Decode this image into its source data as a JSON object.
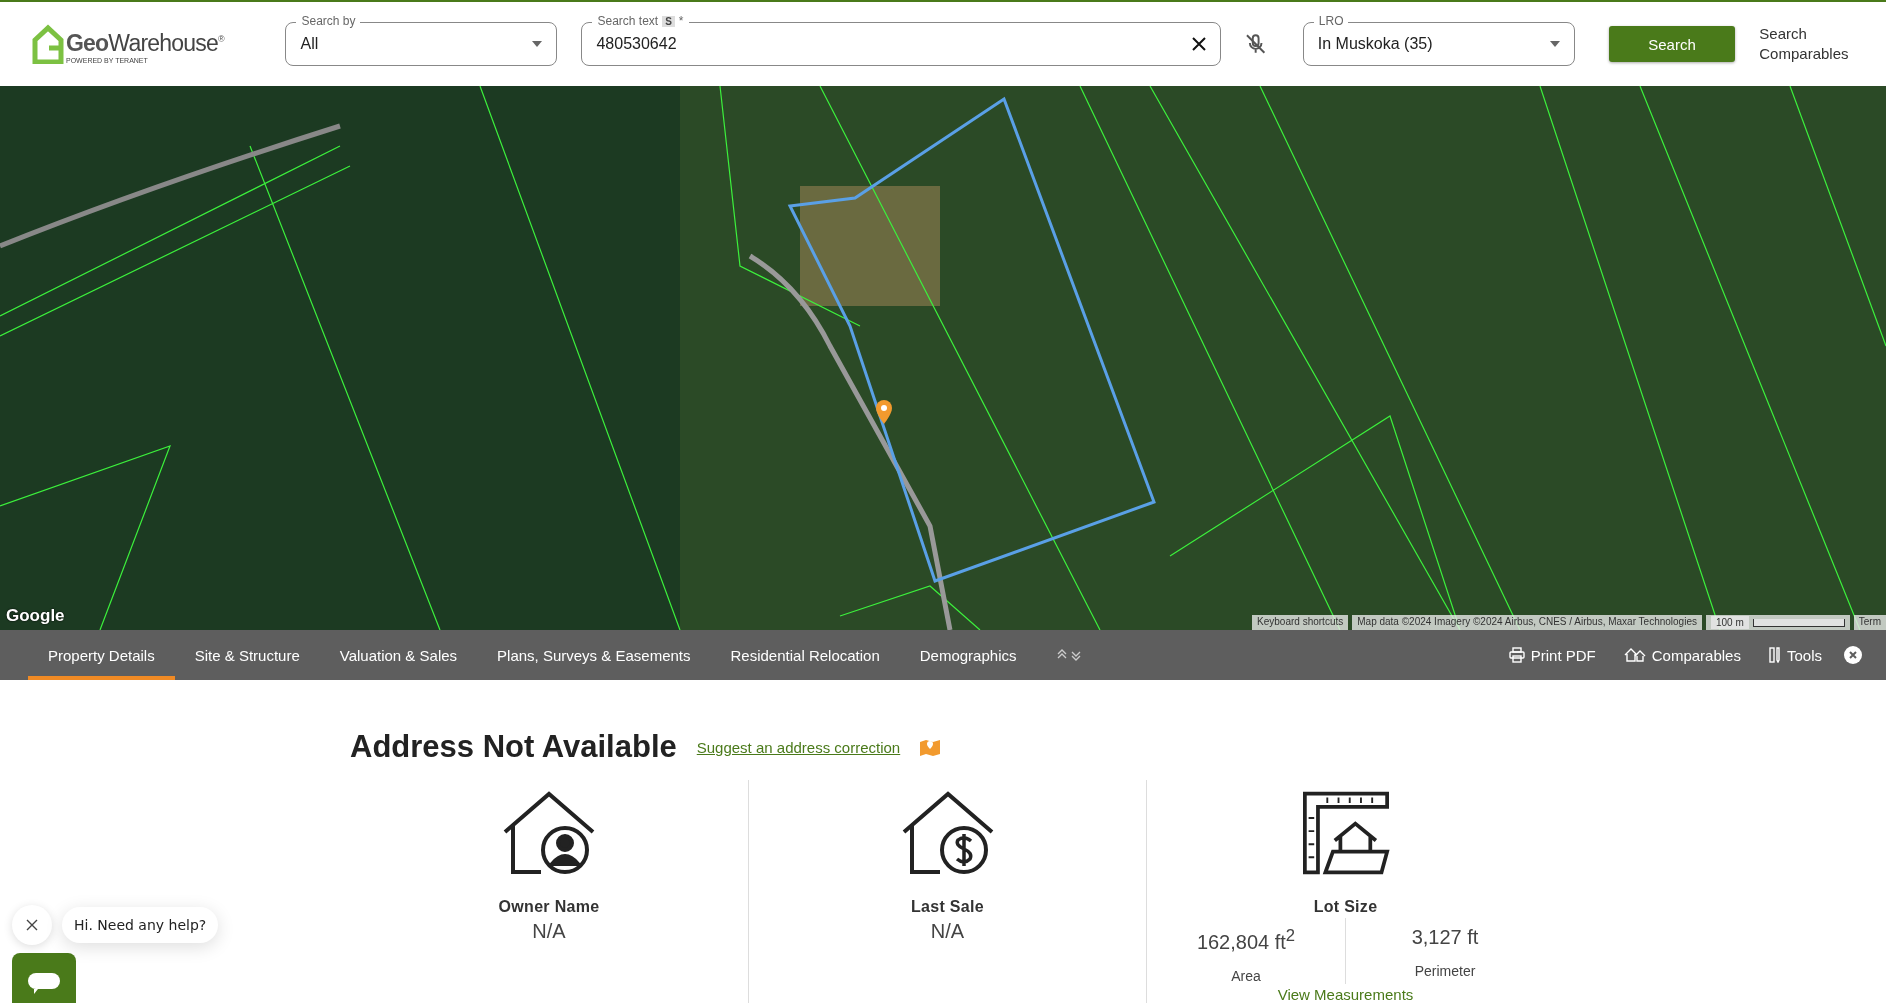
{
  "header": {
    "logo": {
      "name": "**Geo**Warehouse",
      "trademark": "®",
      "tagline": "POWERED BY TERANET"
    },
    "search_by": {
      "label": "Search by",
      "value": "All"
    },
    "search_text": {
      "label": "Search text",
      "badge": "S",
      "required_mark": "*",
      "value": "480530642"
    },
    "lro": {
      "label": "LRO",
      "value": "In Muskoka (35)"
    },
    "search_button": "Search",
    "comparables_link": "Search Comparables"
  },
  "map": {
    "logo": "Google",
    "attribution": [
      "Keyboard shortcuts",
      "Map data ©2024 Imagery ©2024 Airbus, CNES / Airbus, Maxar Technologies"
    ],
    "scale": "100 m",
    "terms": "Term"
  },
  "tabs": [
    {
      "label": "Property Details",
      "selected": true
    },
    {
      "label": "Site & Structure",
      "selected": false
    },
    {
      "label": "Valuation & Sales",
      "selected": false
    },
    {
      "label": "Plans, Surveys & Easements",
      "selected": false
    },
    {
      "label": "Residential Relocation",
      "selected": false
    },
    {
      "label": "Demographics",
      "selected": false
    }
  ],
  "actions": [
    {
      "kind": "print",
      "label": "Print PDF"
    },
    {
      "kind": "comparables",
      "label": "Comparables"
    },
    {
      "kind": "tools",
      "label": "Tools"
    }
  ],
  "property": {
    "title": "Address Not Available",
    "suggest_link": "Suggest an address correction",
    "cards": [
      {
        "kind": "owner",
        "label": "Owner Name",
        "value": "N/A"
      },
      {
        "kind": "sale",
        "label": "Last Sale",
        "value": "N/A"
      },
      {
        "kind": "lot",
        "label": "Lot Size",
        "measures": [
          {
            "value": "162,804 ft$^{2}$",
            "caption": "Area"
          },
          {
            "value": "3,127 ft",
            "caption": "Perimeter"
          }
        ],
        "link": "View Measurements"
      }
    ]
  },
  "chat": {
    "message": "Hi. Need any help?"
  }
}
